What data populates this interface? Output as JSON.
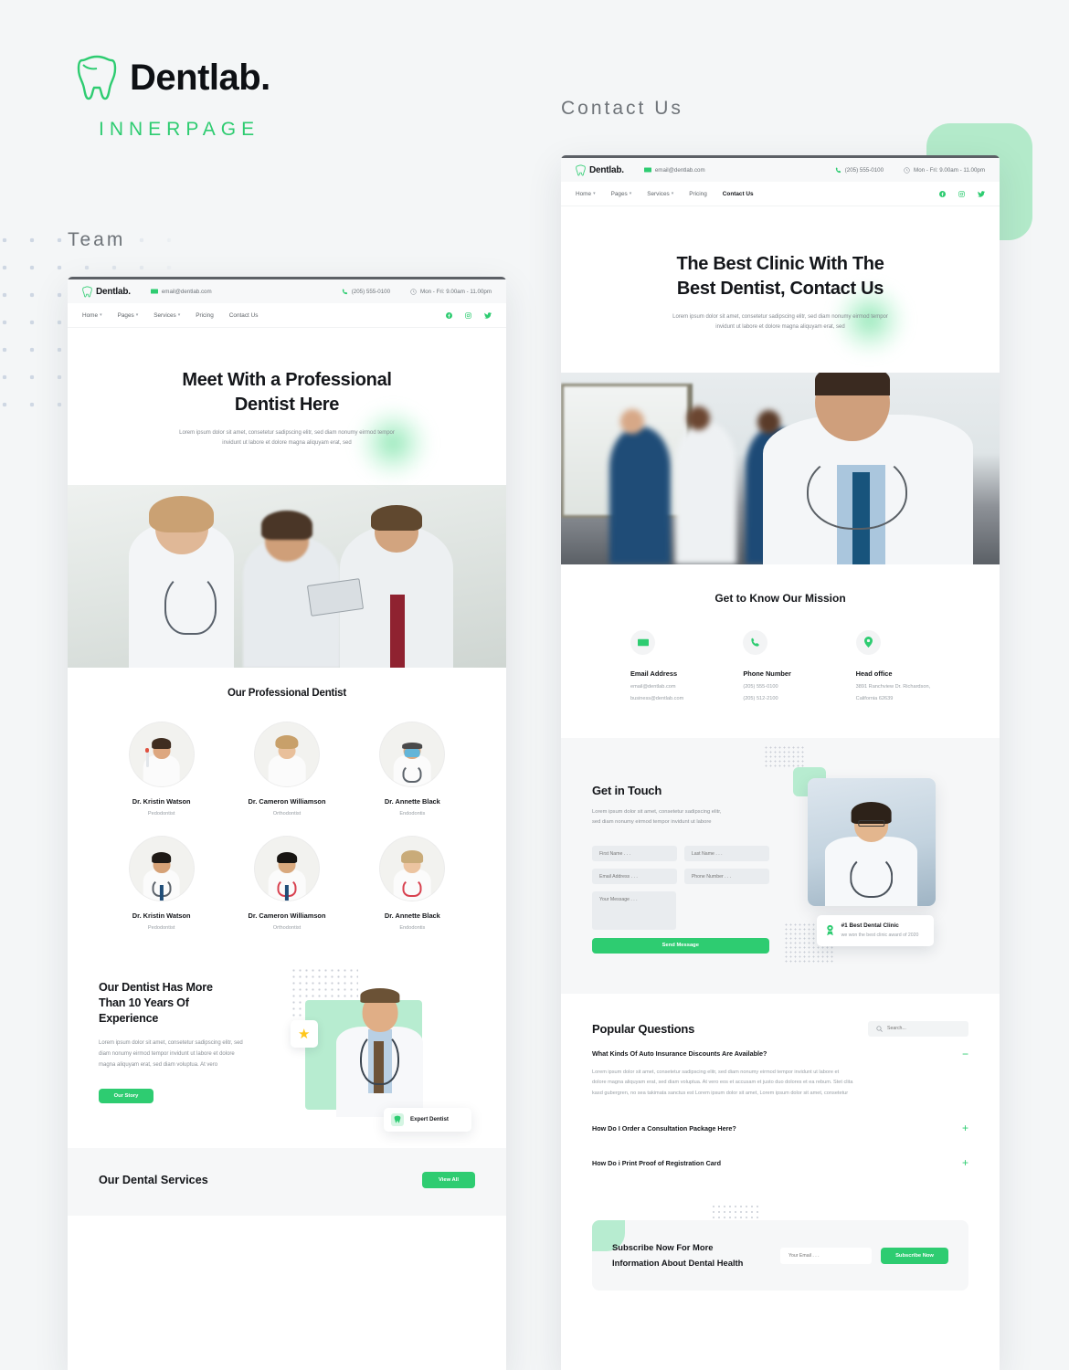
{
  "brand": {
    "name": "Dentlab.",
    "subtitle": "INNERPAGE",
    "logo_icon": "tooth-icon",
    "accent": "#2ecc71"
  },
  "labels": {
    "team": "Team",
    "contact": "Contact Us"
  },
  "site_header": {
    "logo_name": "Dentlab.",
    "email": "email@dentlab.com",
    "phone": "(205) 555-0100",
    "hours": "Mon - Fri: 9.00am - 11.00pm",
    "email_icon": "envelope-icon",
    "phone_icon": "phone-icon",
    "clock_icon": "clock-icon",
    "nav": [
      {
        "label": "Home",
        "caret": true
      },
      {
        "label": "Pages",
        "caret": true
      },
      {
        "label": "Services",
        "caret": true
      },
      {
        "label": "Pricing",
        "caret": false
      },
      {
        "label": "Contact Us",
        "caret": false
      }
    ],
    "social": [
      "facebook-icon",
      "instagram-icon",
      "twitter-icon"
    ]
  },
  "team_page": {
    "hero": {
      "title_line1": "Meet With a Professional",
      "title_line2": "Dentist Here",
      "paragraph_line1": "Lorem ipsum dolor sit amet, consetetur sadipscing elitr, sed diam nonumy eirmod tempor",
      "paragraph_line2": "invidunt ut labore et dolore magna aliquyam erat, sed"
    },
    "team_heading": "Our Professional Dentist",
    "members": [
      {
        "name": "Dr. Kristin Watson",
        "role": "Pedodontist"
      },
      {
        "name": "Dr. Cameron Williamson",
        "role": "Orthodontist"
      },
      {
        "name": "Dr. Annette Black",
        "role": "Endodontis"
      },
      {
        "name": "Dr. Kristin Watson",
        "role": "Pedodontist"
      },
      {
        "name": "Dr. Cameron Williamson",
        "role": "Orthodontist"
      },
      {
        "name": "Dr. Annette Black",
        "role": "Endodontis"
      }
    ],
    "experience": {
      "title_line1": "Our Dentist Has More",
      "title_line2": "Than 10 Years Of",
      "title_line3": "Experience",
      "paragraph_line1": "Lorem ipsum dolor sit amet, consetetur sadipscing elitr, sed",
      "paragraph_line2": "diam nonumy eirmod tempor invidunt ut labore et dolore",
      "paragraph_line3": "magna aliquyam erat, sed diam voluptua. At vero",
      "button": "Our Story",
      "badge_label": "Expert Dentist",
      "badge_icon": "tooth-icon",
      "star_icon": "star-icon"
    },
    "services": {
      "heading": "Our Dental Services",
      "button": "View All"
    }
  },
  "contact_page": {
    "hero": {
      "title_line1": "The Best Clinic With The",
      "title_line2": "Best Dentist, Contact Us",
      "paragraph_line1": "Lorem ipsum dolor sit amet, consetetur sadipscing elitr, sed diam nonumy eirmod tempor",
      "paragraph_line2": "invidunt ut labore et dolore magna aliquyam erat, sed"
    },
    "mission": {
      "heading": "Get to Know Our Mission",
      "items": [
        {
          "icon": "envelope-icon",
          "title": "Email Address",
          "line1": "email@dentlab.com",
          "line2": "business@dentlab.com"
        },
        {
          "icon": "phone-icon",
          "title": "Phone Number",
          "line1": "(205) 555-0100",
          "line2": "(205) 512-2100"
        },
        {
          "icon": "location-pin-icon",
          "title": "Head office",
          "line1": "3891 Ranchview Dr. Richardson,",
          "line2": "California 62639"
        }
      ]
    },
    "get_in_touch": {
      "heading": "Get in Touch",
      "paragraph_line1": "Lorem ipsum dolor sit amet, consetetur sadipscing elitr,",
      "paragraph_line2": "sed diam nonumy eirmod tempor invidunt ut labore",
      "placeholders": {
        "first_name": "First Name . . .",
        "last_name": "Last Name . . .",
        "email": "Email Address . . .",
        "phone": "Phone Number . . .",
        "message": "Your Message . . ."
      },
      "submit": "Send Message",
      "clinic_card": {
        "icon": "award-icon",
        "title": "#1 Best Dental Clinic",
        "subtitle": "we won the best clinic award of 2020"
      }
    },
    "faq": {
      "heading": "Popular Questions",
      "search_placeholder": "Search...",
      "search_icon": "search-icon",
      "items": [
        {
          "question": "What Kinds Of Auto Insurance Discounts Are Available?",
          "sign": "−",
          "answer_line1": "Lorem ipsum dolor sit amet, consetetur sadipscing elitr, sed diam nonumy eirmod tempor invidunt ut labore et",
          "answer_line2": "dolore magna aliquyam erat, sed diam voluptua. At vero eos et accusam et justo duo dolores et ea rebum. Stet clita",
          "answer_line3": "kasd gubergren, no sea takimata sanctus est Lorem ipsum dolor sit amet, Lorem ipsum dolor sit amet, consetetur"
        },
        {
          "question": "How Do I Order a Consultation Package Here?",
          "sign": "+"
        },
        {
          "question": "How Do i Print Proof of Registration Card",
          "sign": "+"
        }
      ]
    },
    "subscribe": {
      "title_line1": "Subscribe Now For More",
      "title_line2": "Information About Dental Health",
      "placeholder": "Your Email . . .",
      "button": "Subscribe Now"
    }
  }
}
